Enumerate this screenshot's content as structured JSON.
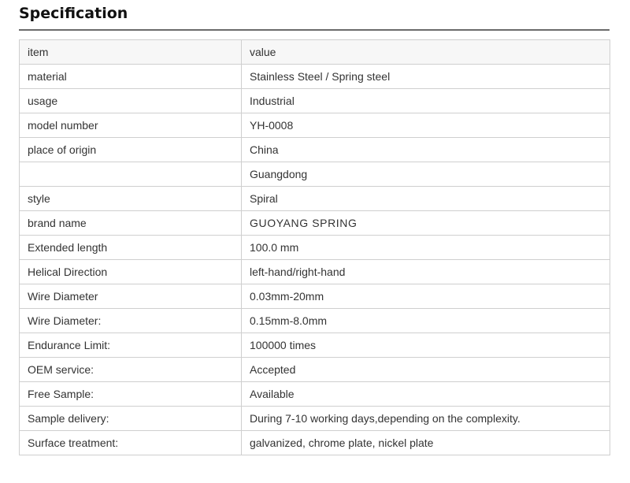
{
  "title": "Specification",
  "table": {
    "headers": [
      "item",
      "value"
    ],
    "rows": [
      [
        "material",
        "Stainless Steel / Spring steel"
      ],
      [
        "usage",
        "Industrial"
      ],
      [
        "model number",
        "YH-0008"
      ],
      [
        "place of origin",
        "China"
      ],
      [
        "",
        "Guangdong"
      ],
      [
        "style",
        "Spiral"
      ],
      [
        "brand name",
        "GUOYANG SPRING"
      ],
      [
        "Extended length",
        "100.0 mm"
      ],
      [
        "Helical Direction",
        "left-hand/right-hand"
      ],
      [
        "Wire Diameter",
        "0.03mm-20mm"
      ],
      [
        "Wire Diameter:",
        "0.15mm-8.0mm"
      ],
      [
        "Endurance Limit:",
        "100000 times"
      ],
      [
        "OEM service:",
        "Accepted"
      ],
      [
        "Free Sample:",
        "Available"
      ],
      [
        "Sample delivery:",
        "During 7-10 working days,depending on the complexity."
      ],
      [
        "Surface treatment:",
        "galvanized, chrome plate, nickel plate"
      ]
    ]
  }
}
